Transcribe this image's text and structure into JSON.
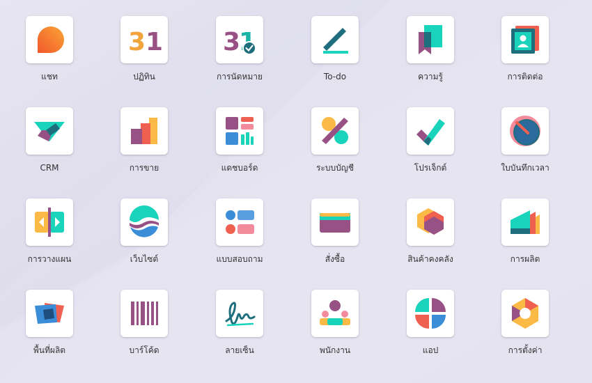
{
  "apps": [
    {
      "label": "แชท",
      "icon": "chat-icon"
    },
    {
      "label": "ปฏิทิน",
      "icon": "calendar-icon"
    },
    {
      "label": "การนัดหมาย",
      "icon": "appointment-icon"
    },
    {
      "label": "To-do",
      "icon": "todo-icon"
    },
    {
      "label": "ความรู้",
      "icon": "knowledge-icon"
    },
    {
      "label": "การติดต่อ",
      "icon": "contacts-icon"
    },
    {
      "label": "CRM",
      "icon": "crm-icon"
    },
    {
      "label": "การขาย",
      "icon": "sales-icon"
    },
    {
      "label": "แดชบอร์ด",
      "icon": "dashboard-icon"
    },
    {
      "label": "ระบบบัญชี",
      "icon": "accounting-icon"
    },
    {
      "label": "โปรเจ็กต์",
      "icon": "project-icon"
    },
    {
      "label": "ใบบันทึกเวลา",
      "icon": "timesheet-icon"
    },
    {
      "label": "การวางแผน",
      "icon": "planning-icon"
    },
    {
      "label": "เว็บไซต์",
      "icon": "website-icon"
    },
    {
      "label": "แบบสอบถาม",
      "icon": "survey-icon"
    },
    {
      "label": "สั่งซื้อ",
      "icon": "purchase-icon"
    },
    {
      "label": "สินค้าคงคลัง",
      "icon": "inventory-icon"
    },
    {
      "label": "การผลิต",
      "icon": "manufacturing-icon"
    },
    {
      "label": "พื้นที่ผลิต",
      "icon": "shop-floor-icon"
    },
    {
      "label": "บาร์โค้ด",
      "icon": "barcode-icon"
    },
    {
      "label": "ลายเซ็น",
      "icon": "sign-icon"
    },
    {
      "label": "พนักงาน",
      "icon": "employees-icon"
    },
    {
      "label": "แอป",
      "icon": "apps-icon"
    },
    {
      "label": "การตั้งค่า",
      "icon": "settings-icon"
    }
  ],
  "colors": {
    "orange": "#f28c28",
    "purple": "#985184",
    "teal": "#1ad3bb",
    "dark_teal": "#1e6e7e",
    "yellow": "#fbb945",
    "red": "#f06050",
    "blue": "#3c8dd8",
    "pink": "#f38b9c"
  }
}
